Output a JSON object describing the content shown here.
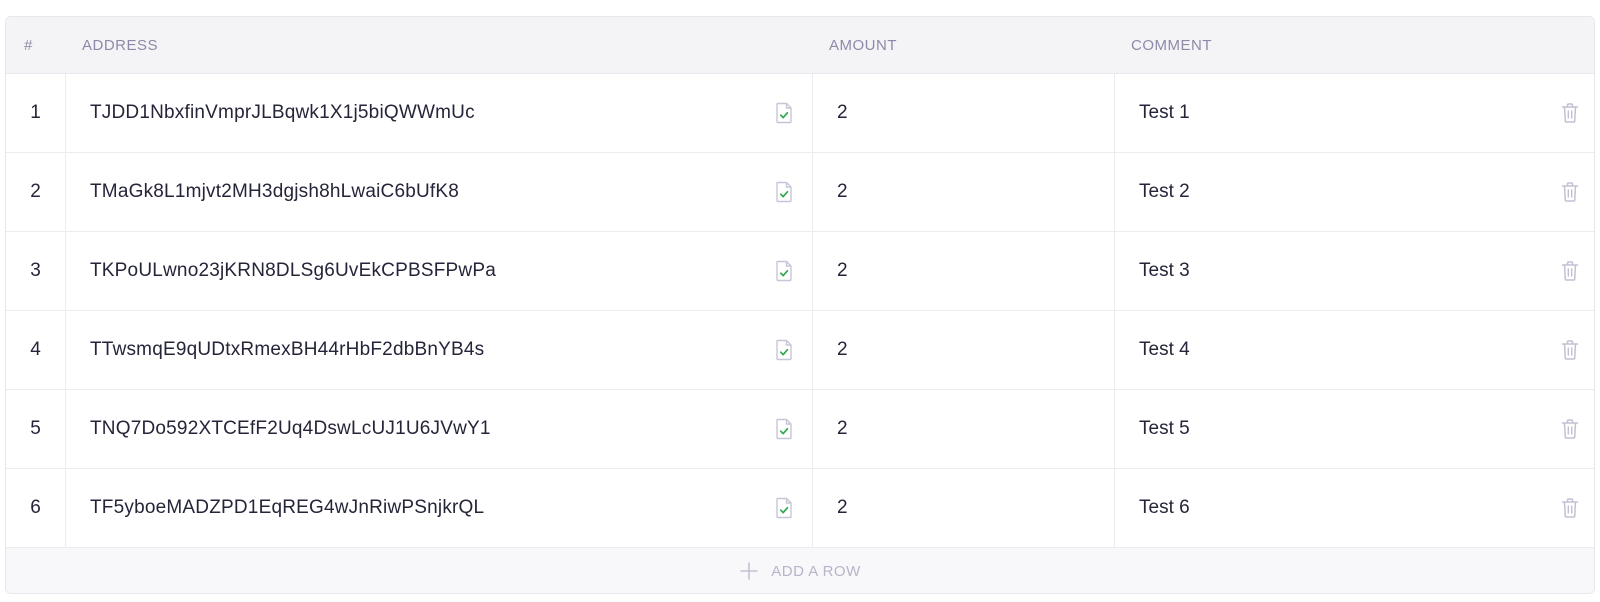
{
  "headers": {
    "num": "#",
    "address": "ADDRESS",
    "amount": "AMOUNT",
    "comment": "COMMENT"
  },
  "rows": [
    {
      "num": "1",
      "address": "TJDD1NbxfinVmprJLBqwk1X1j5biQWWmUc",
      "amount": "2",
      "comment": "Test 1"
    },
    {
      "num": "2",
      "address": "TMaGk8L1mjvt2MH3dgjsh8hLwaiC6bUfK8",
      "amount": "2",
      "comment": "Test 2"
    },
    {
      "num": "3",
      "address": "TKPoULwno23jKRN8DLSg6UvEkCPBSFPwPa",
      "amount": "2",
      "comment": "Test 3"
    },
    {
      "num": "4",
      "address": "TTwsmqE9qUDtxRmexBH44rHbF2dbBnYB4s",
      "amount": "2",
      "comment": "Test 4"
    },
    {
      "num": "5",
      "address": "TNQ7Do592XTCEfF2Uq4DswLcUJ1U6JVwY1",
      "amount": "2",
      "comment": "Test 5"
    },
    {
      "num": "6",
      "address": "TF5yboeMADZPD1EqREG4wJnRiwPSnjkrQL",
      "amount": "2",
      "comment": "Test 6"
    }
  ],
  "footer": {
    "add_row_label": "ADD A ROW"
  },
  "icons": {
    "address_status": "document-check-icon",
    "delete": "trash-icon",
    "add": "plus-icon"
  },
  "colors": {
    "header_text": "#8c8aa8",
    "check_green": "#2fa84f",
    "muted_icon": "#c2c1d3"
  }
}
